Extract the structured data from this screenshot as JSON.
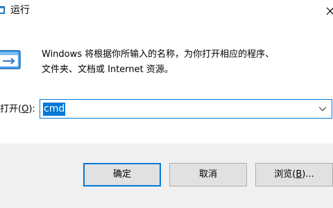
{
  "window": {
    "title": "运行",
    "icon": "run-app-icon",
    "close": "close-icon"
  },
  "description": {
    "line1": "Windows 将根据你所输入的名称，为你打开相应的程序、",
    "line2": "文件夹、文档或 Internet 资源。"
  },
  "open": {
    "label_prefix": "打开(",
    "label_mnemonic": "O",
    "label_suffix": "):",
    "value": "cmd",
    "dropdown_icon": "chevron-down-icon"
  },
  "buttons": {
    "ok": "确定",
    "cancel": "取消",
    "browse_prefix": "浏览(",
    "browse_mnemonic": "B",
    "browse_suffix": ")..."
  },
  "colors": {
    "accent": "#0078d7",
    "footer_bg": "#f0f0f0",
    "button_bg": "#e1e1e1",
    "button_border": "#adadad"
  }
}
